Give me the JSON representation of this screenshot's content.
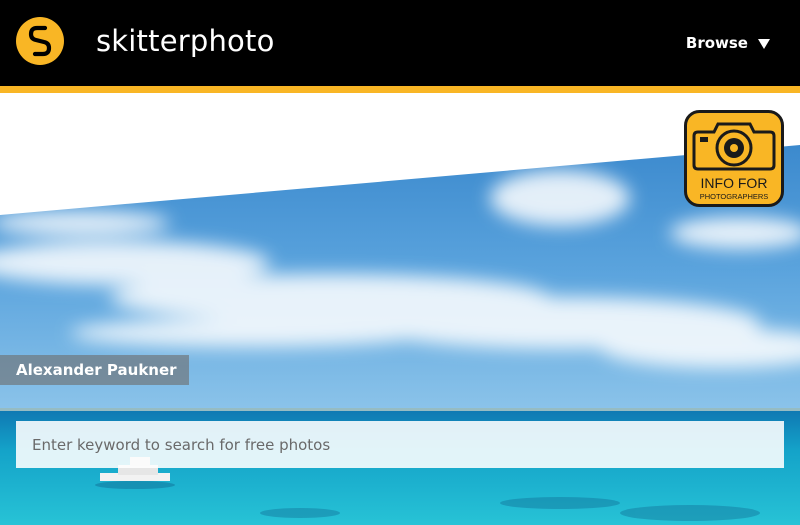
{
  "header": {
    "brand": "skitterphoto",
    "browse_label": "Browse"
  },
  "hero": {
    "photo_credit": "Alexander Paukner",
    "info_badge": {
      "line1": "INFO FOR",
      "line2": "PHOTOGRAPHERS"
    }
  },
  "search": {
    "placeholder": "Enter keyword to search for free photos",
    "value": ""
  },
  "colors": {
    "header_bg": "#000000",
    "accent": "#f9b625",
    "sky": "#3f8fd0",
    "sea": "#1aa6c8"
  },
  "icons": {
    "logo": "skitterphoto-logo-icon",
    "browse_caret": "caret-down-icon",
    "camera": "camera-icon"
  }
}
